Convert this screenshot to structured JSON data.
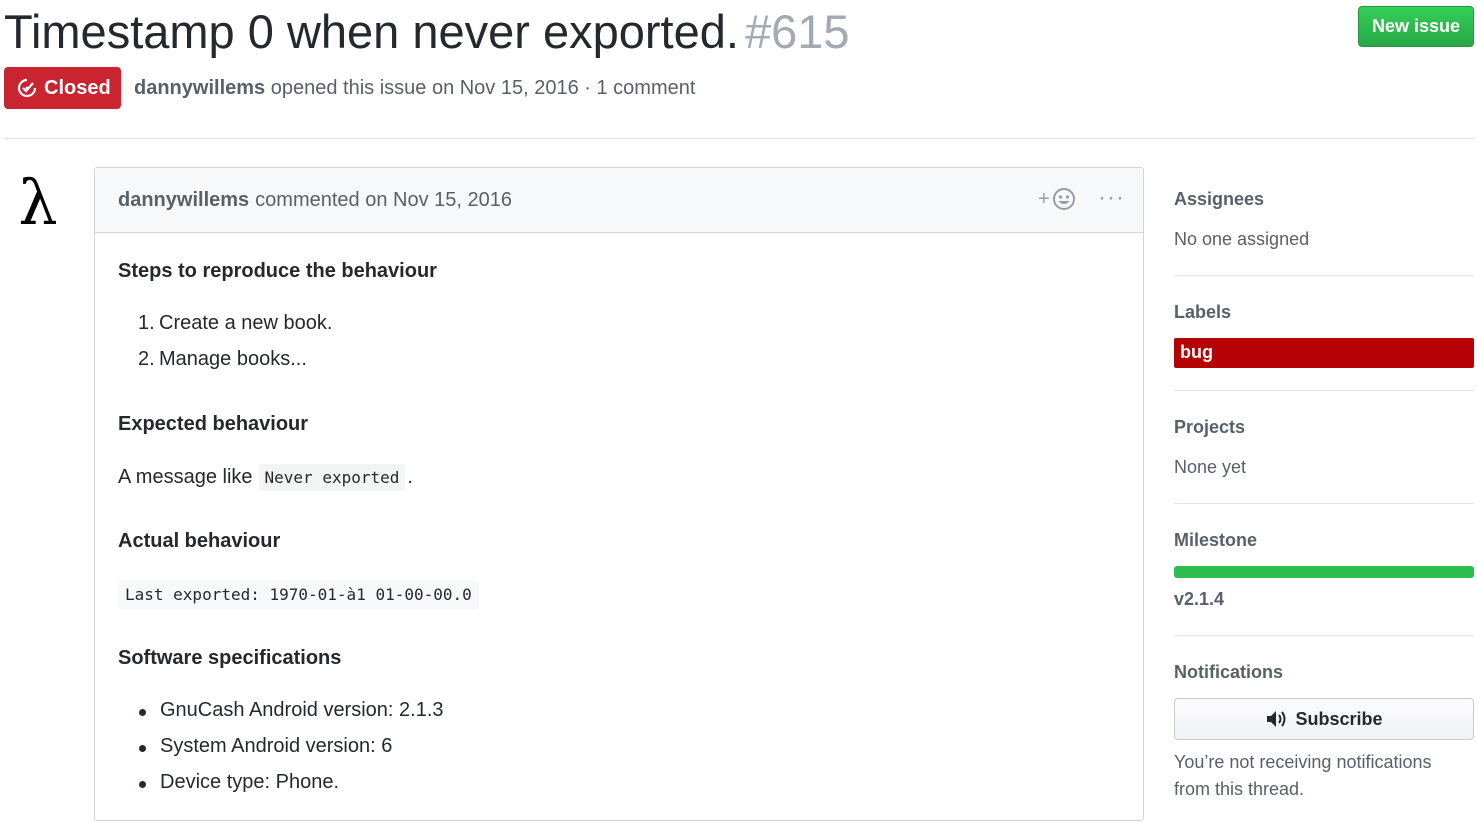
{
  "issue": {
    "title": "Timestamp 0 when never exported.",
    "number": "#615",
    "new_issue_label": "New issue",
    "state_label": "Closed",
    "author": "dannywillems",
    "opened_text": "opened this issue on Nov 15, 2016 · 1 comment"
  },
  "comment": {
    "author": "dannywillems",
    "commented_text": "commented on Nov 15, 2016",
    "reaction_plus": "+",
    "more_label": "···",
    "avatar_glyph": "λ",
    "body": {
      "h_steps": "Steps to reproduce the behaviour",
      "steps": [
        {
          "num": "1.",
          "text": "Create a new book."
        },
        {
          "num": "2.",
          "text": "Manage books..."
        }
      ],
      "h_expected": "Expected behaviour",
      "expected_prefix": "A message like",
      "expected_code": "Never exported",
      "expected_suffix": ".",
      "h_actual": "Actual behaviour",
      "actual_code": "Last exported: 1970-01-à1 01-00-00.0",
      "h_software": "Software specifications",
      "specs": [
        "GnuCash Android version: 2.1.3",
        "System Android version: 6",
        "Device type: Phone."
      ]
    }
  },
  "sidebar": {
    "assignees_heading": "Assignees",
    "assignees_value": "No one assigned",
    "labels_heading": "Labels",
    "label_bug": "bug",
    "projects_heading": "Projects",
    "projects_value": "None yet",
    "milestone_heading": "Milestone",
    "milestone_name": "v2.1.4",
    "milestone_progress": 1.0,
    "notifications_heading": "Notifications",
    "subscribe_label": "Subscribe",
    "notifications_note": "You’re not receiving notifications from this thread."
  },
  "colors": {
    "closed_red": "#cb2431",
    "new_issue_green": "#28a745",
    "label_bug": "#b60205",
    "milestone_green": "#2cbe4e"
  },
  "icons": [
    "issue-closed-icon",
    "smiley-icon",
    "kebab-horizontal-icon",
    "unmute-icon"
  ]
}
